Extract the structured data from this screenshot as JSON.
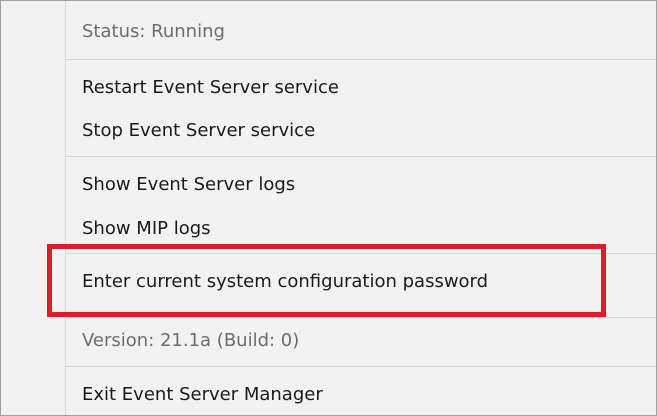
{
  "menu": {
    "status_label": "Status: Running",
    "restart_label": "Restart Event Server service",
    "stop_label": "Stop Event Server service",
    "show_event_logs_label": "Show Event Server logs",
    "show_mip_logs_label": "Show MIP logs",
    "enter_password_label": "Enter current system configuration password",
    "version_label": "Version: 21.1a (Build: 0)",
    "exit_label": "Exit Event Server Manager"
  },
  "annotation": {
    "highlight_color": "#dc1e2a",
    "highlighted_item": "Enter current system configuration password"
  }
}
